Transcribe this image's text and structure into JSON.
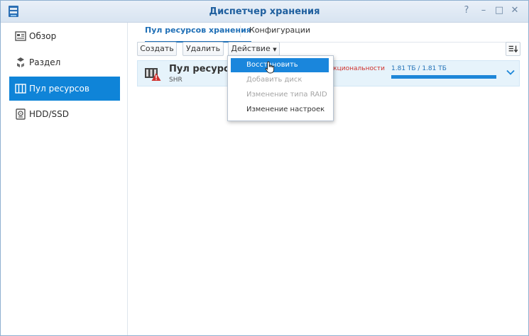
{
  "window": {
    "title": "Диспетчер хранения"
  },
  "sidebar": {
    "items": [
      {
        "label": "Обзор",
        "icon": "overview-icon"
      },
      {
        "label": "Раздел",
        "icon": "volume-icon"
      },
      {
        "label": "Пул ресурсов хранения",
        "icon": "storage-pool-icon"
      },
      {
        "label": "HDD/SSD",
        "icon": "disk-icon"
      }
    ],
    "active_index": 2
  },
  "tabs": [
    {
      "label": "Пул ресурсов хранения"
    },
    {
      "label": "Конфигурации"
    }
  ],
  "toolbar": {
    "create_label": "Создать",
    "delete_label": "Удалить",
    "action_label": "Действие"
  },
  "pool": {
    "name": "Пул ресурсов",
    "type": "SHR",
    "status": "ункциональности",
    "capacity": "1.81 ТБ / 1.81 ТБ",
    "usage_fraction": 1.0
  },
  "action_menu": {
    "items": [
      {
        "label": "Восстановить",
        "state": "highlighted"
      },
      {
        "label": "Добавить диск",
        "state": "disabled"
      },
      {
        "label": "Изменение типа RAID",
        "state": "disabled"
      },
      {
        "label": "Изменение настроек",
        "state": "enabled"
      }
    ]
  },
  "colors": {
    "accent": "#0f84d8",
    "warning": "#d0312d"
  }
}
